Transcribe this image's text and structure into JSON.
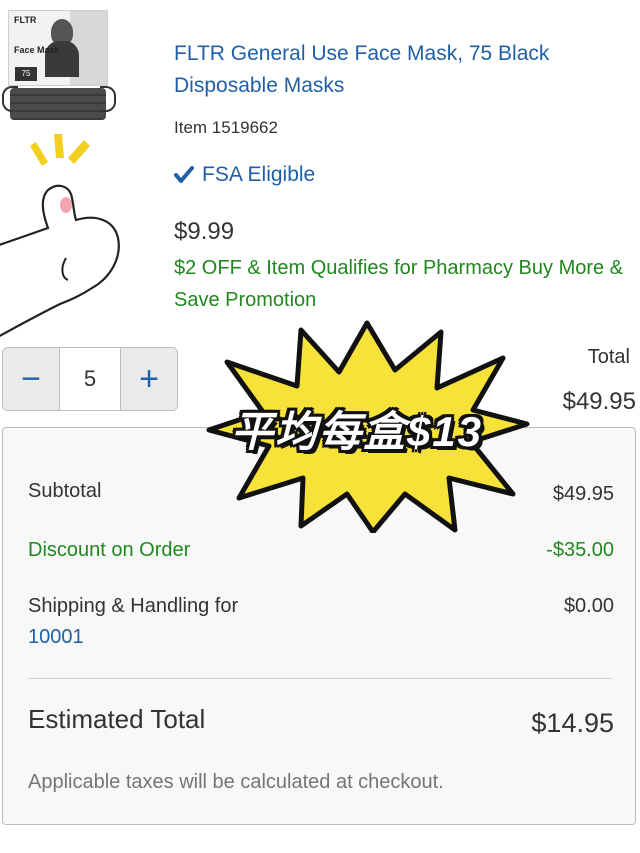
{
  "product": {
    "image_box": {
      "brand": "FLTR",
      "title": "Face Mask",
      "count": "75"
    },
    "title": "FLTR General Use Face Mask, 75 Black Disposable Masks",
    "item_number": "Item 1519662",
    "fsa_label": "FSA Eligible",
    "price": "$9.99",
    "promotion": "$2 OFF & Item Qualifies for Pharmacy Buy More & Save Promotion"
  },
  "quantity": {
    "decrement": "−",
    "value": "5",
    "increment": "+"
  },
  "line_total": {
    "label": "Total",
    "value": "$49.95"
  },
  "summary": {
    "subtotal_label": "Subtotal",
    "subtotal_value": "$49.95",
    "discount_label": "Discount on Order",
    "discount_value": "-$35.00",
    "shipping_label": "Shipping & Handling for",
    "shipping_zip": "10001",
    "shipping_value": "$0.00",
    "estimated_total_label": "Estimated Total",
    "estimated_total_value": "$14.95",
    "tax_note": "Applicable taxes will be calculated at checkout."
  },
  "overlay": {
    "sticker_text": "平均每盒$13"
  },
  "colors": {
    "link_blue": "#1f5fa8",
    "promo_green": "#21871f",
    "burst_yellow": "#f7e23a"
  }
}
